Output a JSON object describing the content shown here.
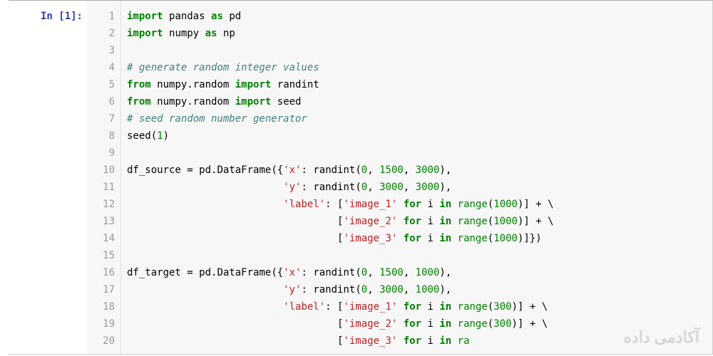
{
  "prompt": {
    "label": "In [1]:"
  },
  "gutter": {
    "lines": [
      "1",
      "2",
      "3",
      "4",
      "5",
      "6",
      "7",
      "8",
      "9",
      "10",
      "11",
      "12",
      "13",
      "14",
      "15",
      "16",
      "17",
      "18",
      "19",
      "20"
    ]
  },
  "code": {
    "lines": [
      [
        [
          "kw",
          "import"
        ],
        [
          "pn",
          " "
        ],
        [
          "id",
          "pandas"
        ],
        [
          "pn",
          " "
        ],
        [
          "kw",
          "as"
        ],
        [
          "pn",
          " "
        ],
        [
          "id",
          "pd"
        ]
      ],
      [
        [
          "kw",
          "import"
        ],
        [
          "pn",
          " "
        ],
        [
          "id",
          "numpy"
        ],
        [
          "pn",
          " "
        ],
        [
          "kw",
          "as"
        ],
        [
          "pn",
          " "
        ],
        [
          "id",
          "np"
        ]
      ],
      [],
      [
        [
          "cm",
          "# generate random integer values"
        ]
      ],
      [
        [
          "kw",
          "from"
        ],
        [
          "pn",
          " "
        ],
        [
          "id",
          "numpy.random"
        ],
        [
          "pn",
          " "
        ],
        [
          "kw",
          "import"
        ],
        [
          "pn",
          " "
        ],
        [
          "id",
          "randint"
        ]
      ],
      [
        [
          "kw",
          "from"
        ],
        [
          "pn",
          " "
        ],
        [
          "id",
          "numpy.random"
        ],
        [
          "pn",
          " "
        ],
        [
          "kw",
          "import"
        ],
        [
          "pn",
          " "
        ],
        [
          "id",
          "seed"
        ]
      ],
      [
        [
          "cm",
          "# seed random number generator"
        ]
      ],
      [
        [
          "id",
          "seed"
        ],
        [
          "pn",
          "("
        ],
        [
          "num",
          "1"
        ],
        [
          "pn",
          ")"
        ]
      ],
      [],
      [
        [
          "id",
          "df_source"
        ],
        [
          "pn",
          " "
        ],
        [
          "op",
          "="
        ],
        [
          "pn",
          " "
        ],
        [
          "id",
          "pd.DataFrame"
        ],
        [
          "pn",
          "({"
        ],
        [
          "str",
          "'x'"
        ],
        [
          "pn",
          ": "
        ],
        [
          "id",
          "randint"
        ],
        [
          "pn",
          "("
        ],
        [
          "num",
          "0"
        ],
        [
          "pn",
          ", "
        ],
        [
          "num",
          "1500"
        ],
        [
          "pn",
          ", "
        ],
        [
          "num",
          "3000"
        ],
        [
          "pn",
          "),"
        ]
      ],
      [
        [
          "pn",
          "                          "
        ],
        [
          "str",
          "'y'"
        ],
        [
          "pn",
          ": "
        ],
        [
          "id",
          "randint"
        ],
        [
          "pn",
          "("
        ],
        [
          "num",
          "0"
        ],
        [
          "pn",
          ", "
        ],
        [
          "num",
          "3000"
        ],
        [
          "pn",
          ", "
        ],
        [
          "num",
          "3000"
        ],
        [
          "pn",
          "),"
        ]
      ],
      [
        [
          "pn",
          "                          "
        ],
        [
          "str",
          "'label'"
        ],
        [
          "pn",
          ": ["
        ],
        [
          "str",
          "'image_1'"
        ],
        [
          "pn",
          " "
        ],
        [
          "kw",
          "for"
        ],
        [
          "pn",
          " "
        ],
        [
          "id",
          "i"
        ],
        [
          "pn",
          " "
        ],
        [
          "kw",
          "in"
        ],
        [
          "pn",
          " "
        ],
        [
          "bi",
          "range"
        ],
        [
          "pn",
          "("
        ],
        [
          "num",
          "1000"
        ],
        [
          "pn",
          ")] "
        ],
        [
          "op",
          "+"
        ],
        [
          "pn",
          " "
        ],
        [
          "op",
          "\\"
        ]
      ],
      [
        [
          "pn",
          "                                   ["
        ],
        [
          "str",
          "'image_2'"
        ],
        [
          "pn",
          " "
        ],
        [
          "kw",
          "for"
        ],
        [
          "pn",
          " "
        ],
        [
          "id",
          "i"
        ],
        [
          "pn",
          " "
        ],
        [
          "kw",
          "in"
        ],
        [
          "pn",
          " "
        ],
        [
          "bi",
          "range"
        ],
        [
          "pn",
          "("
        ],
        [
          "num",
          "1000"
        ],
        [
          "pn",
          ")] "
        ],
        [
          "op",
          "+"
        ],
        [
          "pn",
          " "
        ],
        [
          "op",
          "\\"
        ]
      ],
      [
        [
          "pn",
          "                                   ["
        ],
        [
          "str",
          "'image_3'"
        ],
        [
          "pn",
          " "
        ],
        [
          "kw",
          "for"
        ],
        [
          "pn",
          " "
        ],
        [
          "id",
          "i"
        ],
        [
          "pn",
          " "
        ],
        [
          "kw",
          "in"
        ],
        [
          "pn",
          " "
        ],
        [
          "bi",
          "range"
        ],
        [
          "pn",
          "("
        ],
        [
          "num",
          "1000"
        ],
        [
          "pn",
          ")]})"
        ]
      ],
      [],
      [
        [
          "id",
          "df_target"
        ],
        [
          "pn",
          " "
        ],
        [
          "op",
          "="
        ],
        [
          "pn",
          " "
        ],
        [
          "id",
          "pd.DataFrame"
        ],
        [
          "pn",
          "({"
        ],
        [
          "str",
          "'x'"
        ],
        [
          "pn",
          ": "
        ],
        [
          "id",
          "randint"
        ],
        [
          "pn",
          "("
        ],
        [
          "num",
          "0"
        ],
        [
          "pn",
          ", "
        ],
        [
          "num",
          "1500"
        ],
        [
          "pn",
          ", "
        ],
        [
          "num",
          "1000"
        ],
        [
          "pn",
          "),"
        ]
      ],
      [
        [
          "pn",
          "                          "
        ],
        [
          "str",
          "'y'"
        ],
        [
          "pn",
          ": "
        ],
        [
          "id",
          "randint"
        ],
        [
          "pn",
          "("
        ],
        [
          "num",
          "0"
        ],
        [
          "pn",
          ", "
        ],
        [
          "num",
          "3000"
        ],
        [
          "pn",
          ", "
        ],
        [
          "num",
          "1000"
        ],
        [
          "pn",
          "),"
        ]
      ],
      [
        [
          "pn",
          "                          "
        ],
        [
          "str",
          "'label'"
        ],
        [
          "pn",
          ": ["
        ],
        [
          "str",
          "'image_1'"
        ],
        [
          "pn",
          " "
        ],
        [
          "kw",
          "for"
        ],
        [
          "pn",
          " "
        ],
        [
          "id",
          "i"
        ],
        [
          "pn",
          " "
        ],
        [
          "kw",
          "in"
        ],
        [
          "pn",
          " "
        ],
        [
          "bi",
          "range"
        ],
        [
          "pn",
          "("
        ],
        [
          "num",
          "300"
        ],
        [
          "pn",
          ")] "
        ],
        [
          "op",
          "+"
        ],
        [
          "pn",
          " "
        ],
        [
          "op",
          "\\"
        ]
      ],
      [
        [
          "pn",
          "                                   ["
        ],
        [
          "str",
          "'image_2'"
        ],
        [
          "pn",
          " "
        ],
        [
          "kw",
          "for"
        ],
        [
          "pn",
          " "
        ],
        [
          "id",
          "i"
        ],
        [
          "pn",
          " "
        ],
        [
          "kw",
          "in"
        ],
        [
          "pn",
          " "
        ],
        [
          "bi",
          "range"
        ],
        [
          "pn",
          "("
        ],
        [
          "num",
          "300"
        ],
        [
          "pn",
          ")] "
        ],
        [
          "op",
          "+"
        ],
        [
          "pn",
          " "
        ],
        [
          "op",
          "\\"
        ]
      ],
      [
        [
          "pn",
          "                                   ["
        ],
        [
          "str",
          "'image_3'"
        ],
        [
          "pn",
          " "
        ],
        [
          "kw",
          "for"
        ],
        [
          "pn",
          " "
        ],
        [
          "id",
          "i"
        ],
        [
          "pn",
          " "
        ],
        [
          "kw",
          "in"
        ],
        [
          "pn",
          " "
        ],
        [
          "bi",
          "ra"
        ]
      ]
    ]
  },
  "watermark": {
    "text": "آکادمی داده"
  }
}
